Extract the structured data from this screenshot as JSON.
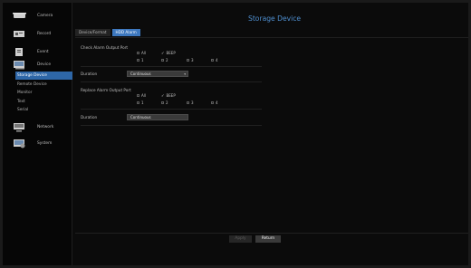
{
  "page": {
    "title": "Storage Device"
  },
  "sidebar": {
    "items": [
      {
        "label": "Camera",
        "icon": "camera-icon"
      },
      {
        "label": "Record",
        "icon": "record-icon"
      },
      {
        "label": "Event",
        "icon": "event-icon"
      },
      {
        "label": "Device",
        "icon": "device-icon"
      }
    ],
    "device_subitems": [
      {
        "label": "Storage Device",
        "active": true
      },
      {
        "label": "Remote Device",
        "active": false
      },
      {
        "label": "Monitor",
        "active": false
      },
      {
        "label": "Text",
        "active": false
      },
      {
        "label": "Serial",
        "active": false
      }
    ],
    "items_after": [
      {
        "label": "Network",
        "icon": "network-icon"
      },
      {
        "label": "System",
        "icon": "system-icon"
      }
    ]
  },
  "tabs": [
    {
      "label": "Device/Format",
      "active": false
    },
    {
      "label": "HDD Alarm",
      "active": true
    }
  ],
  "check_alarm": {
    "label": "Check Alarm Output Port",
    "options": {
      "all": "All",
      "beep": "BEEP",
      "p1": "1",
      "p2": "2",
      "p3": "3",
      "p4": "4"
    },
    "checked": [
      "BEEP"
    ],
    "duration_label": "Duration",
    "duration_value": "Continuous"
  },
  "replace_alarm": {
    "label": "Replace Alarm Output Port",
    "options": {
      "all": "All",
      "beep": "BEEP",
      "p1": "1",
      "p2": "2",
      "p3": "3",
      "p4": "4"
    },
    "checked": [
      "BEEP"
    ],
    "duration_label": "Duration",
    "duration_value": "Continuous"
  },
  "footer": {
    "apply_label": "Apply",
    "return_label": "Return"
  },
  "colors": {
    "accent": "#3d78bf",
    "title": "#4f8fd0",
    "active_nav": "#2e67a8"
  }
}
